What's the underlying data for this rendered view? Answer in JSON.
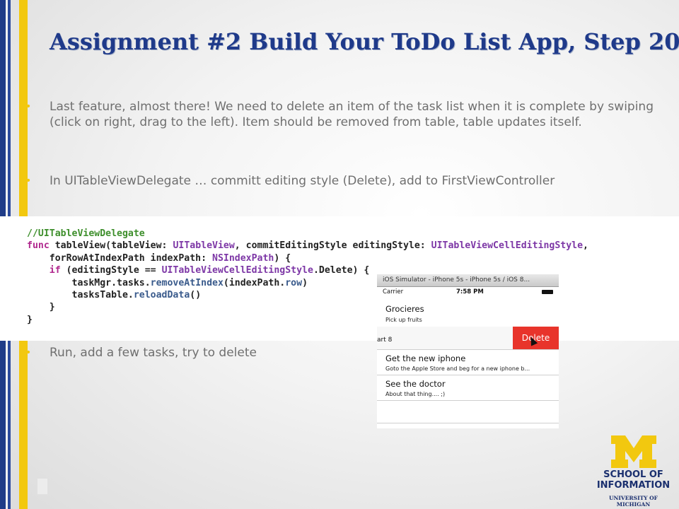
{
  "slide": {
    "title": "Assignment #2 Build Your ToDo List App, Step 20",
    "bullets": [
      "Last feature, almost there!  We need to delete an item of the task list when it is complete by swiping (click on right, drag to the left).   Item should be removed from table, table updates itself.",
      "In UITableViewDelegate   …  committ editing style (Delete), add to FirstViewController",
      "Run, add a few tasks, try to delete"
    ],
    "bullet_marker": "•",
    "accent_colors": {
      "navy": "#1f3a8a",
      "gold": "#f2c80f"
    }
  },
  "code": {
    "line1": "//UITableViewDelegate",
    "line2_kw": "func",
    "line2_a": " tableView(tableView: ",
    "line2_type1": "UITableView",
    "line2_b": ", commitEditingStyle editingStyle: ",
    "line2_type2": "UITableViewCellEditingStyle",
    "line2_c": ",",
    "line3_a": "    forRowAtIndexPath indexPath: ",
    "line3_type": "NSIndexPath",
    "line3_b": ") {",
    "line4_kw": "    if",
    "line4_a": " (editingStyle == ",
    "line4_type": "UITableViewCellEditingStyle",
    "line4_b": ".Delete) {",
    "line5_a": "        taskMgr.tasks.",
    "line5_call": "removeAtIndex",
    "line5_b": "(indexPath.",
    "line5_c": "row",
    "line5_d": ")",
    "line6_a": "        tasksTable.",
    "line6_call": "reloadData",
    "line6_b": "()",
    "line7": "    }",
    "line8": "}"
  },
  "simulator": {
    "window_title": "iOS Simulator - iPhone 5s - iPhone 5s / iOS 8...",
    "carrier": "Carrier",
    "time": "7:58 PM",
    "rows": [
      {
        "title": "Grocieres",
        "subtitle": "Pick up fruits"
      },
      {
        "fragment": "art 8",
        "action": "Delete"
      },
      {
        "title": "Get the new iphone",
        "subtitle": "Goto the Apple Store and beg for a new iphone b..."
      },
      {
        "title": "See the doctor",
        "subtitle": "About that thing.... ;)"
      }
    ]
  },
  "logo": {
    "line1": "SCHOOL OF",
    "line2": "INFORMATION",
    "line3": "UNIVERSITY OF MICHIGAN"
  }
}
